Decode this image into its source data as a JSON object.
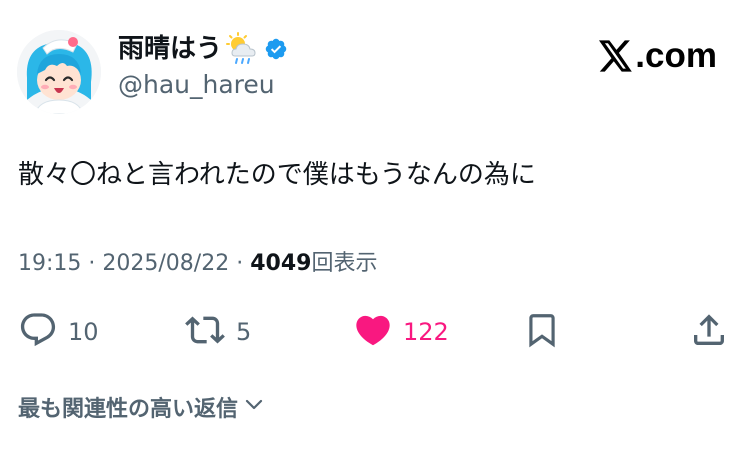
{
  "author": {
    "display_name": "雨晴はう",
    "handle": "@hau_hareu",
    "weather_icon": "sun-behind-rain-cloud-icon",
    "verified_icon": "verified-badge-icon",
    "avatar_icon": "anime-avatar"
  },
  "brand": {
    "label": ".com",
    "icon": "x-logo-icon"
  },
  "tweet": {
    "text": "散々〇ねと言われたので僕はもうなんの為に"
  },
  "meta": {
    "time": "19:15",
    "separator": "·",
    "date": "2025/08/22",
    "views_count": "4049",
    "views_label": "回表示"
  },
  "actions": {
    "reply_count": "10",
    "repost_count": "5",
    "like_count": "122",
    "liked": true
  },
  "replies_sort": {
    "label": "最も関連性の高い返信"
  },
  "colors": {
    "text_primary": "#0f1419",
    "text_secondary": "#536471",
    "like_active": "#f91880",
    "verified": "#1d9bf0"
  }
}
